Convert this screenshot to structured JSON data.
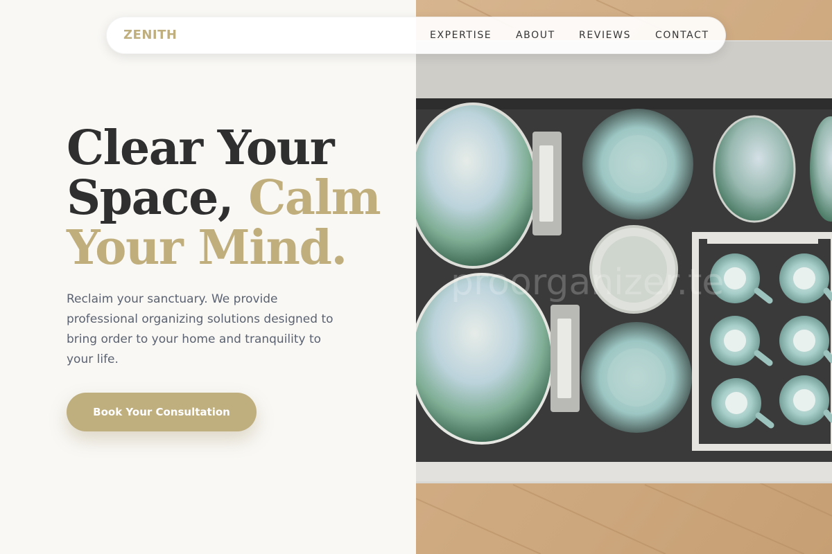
{
  "brand": {
    "logo": "ZENITH"
  },
  "nav": {
    "links": [
      {
        "label": "EXPERTISE"
      },
      {
        "label": "ABOUT"
      },
      {
        "label": "REVIEWS"
      },
      {
        "label": "CONTACT"
      }
    ]
  },
  "hero": {
    "headline_line1": "Clear Your",
    "headline_line2_dark": "Space, ",
    "headline_line2_gold": "Calm",
    "headline_line3": "Your Mind.",
    "subtext": "Reclaim your sanctuary. We provide professional organizing solutions designed to bring order to your home and tranquility to your life.",
    "cta_label": "Book Your Consultation"
  },
  "image": {
    "subject": "drawer organized with ceramic plates, bowls and cups",
    "watermark_text": "proorganizer.te"
  },
  "colors": {
    "accent_gold": "#bfae7e",
    "heading_dark": "#2f2f2f",
    "body_text": "#5b6270",
    "page_bg": "#f9f8f5"
  }
}
